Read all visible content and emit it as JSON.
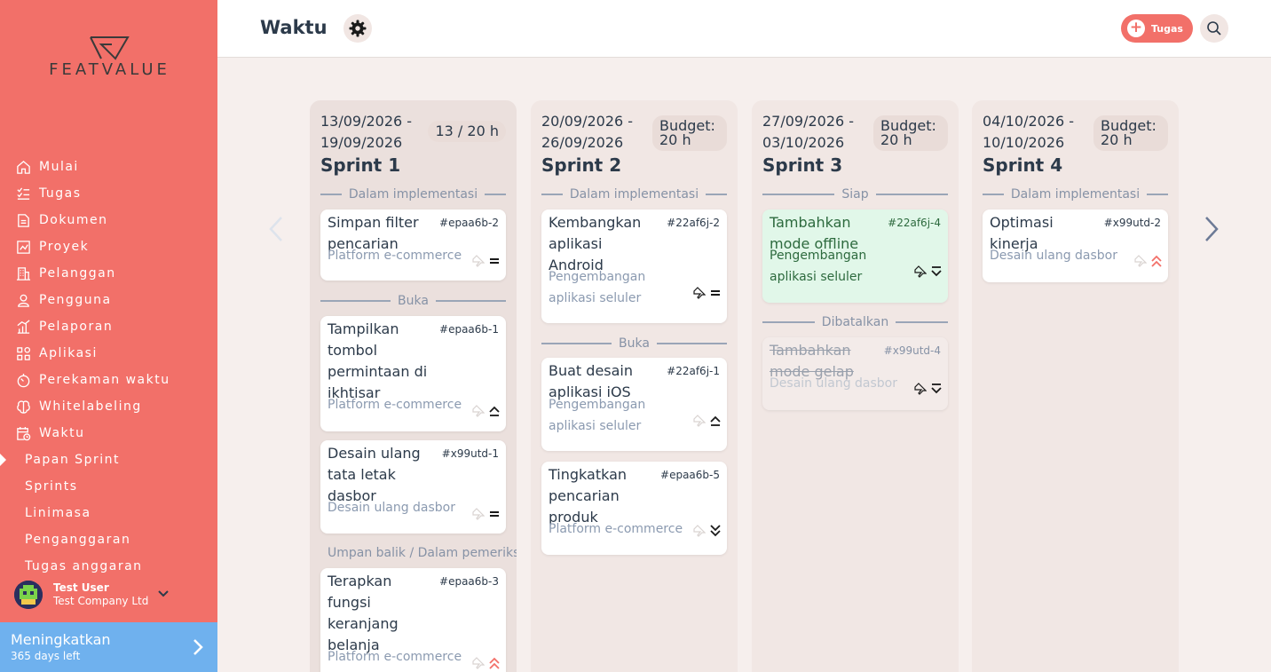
{
  "brand": {
    "name": "FEATVALUE"
  },
  "nav": {
    "items": [
      {
        "label": "Mulai",
        "icon": "home-icon"
      },
      {
        "label": "Tugas",
        "icon": "checklist-icon"
      },
      {
        "label": "Dokumen",
        "icon": "document-icon"
      },
      {
        "label": "Proyek",
        "icon": "project-icon"
      },
      {
        "label": "Pelanggan",
        "icon": "building-icon"
      },
      {
        "label": "Pengguna",
        "icon": "user-icon"
      },
      {
        "label": "Pelaporan",
        "icon": "report-icon"
      },
      {
        "label": "Aplikasi",
        "icon": "apps-icon"
      },
      {
        "label": "Perekaman waktu",
        "icon": "timer-icon"
      },
      {
        "label": "Whitelabeling",
        "icon": "brain-icon"
      },
      {
        "label": "Waktu",
        "icon": "calendar-clock-icon"
      }
    ],
    "sub_items": [
      {
        "label": "Papan Sprint",
        "active": true
      },
      {
        "label": "Sprints"
      },
      {
        "label": "Linimasa"
      },
      {
        "label": "Penganggaran"
      },
      {
        "label": "Tugas anggaran"
      }
    ]
  },
  "user": {
    "name": "Test User",
    "company": "Test Company Ltd"
  },
  "upgrade": {
    "title": "Meningkatkan",
    "subtitle": "365 days left"
  },
  "header": {
    "title": "Waktu",
    "task_button": "Tugas"
  },
  "sprints": [
    {
      "dates": "13/09/2026 - 19/09/2026",
      "badge": "13 / 20 h",
      "title": "Sprint 1",
      "groups": [
        {
          "label": "Dalam implementasi",
          "cards": [
            {
              "title": "Simpan filter pencarian",
              "id": "#epaa6b-2",
              "project": "Platform e-commerce",
              "priority": "medium"
            }
          ]
        },
        {
          "label": "Buka",
          "cards": [
            {
              "title": "Tampilkan tombol permintaan di ikhtisar",
              "id": "#epaa6b-1",
              "project": "Platform e-commerce",
              "priority": "high"
            },
            {
              "title": "Desain ulang tata letak dasbor",
              "id": "#x99utd-1",
              "project": "Desain ulang dasbor",
              "priority": "medium"
            }
          ]
        },
        {
          "label": "Umpan balik / Dalam pemeriksaan",
          "cards": [
            {
              "title": "Terapkan fungsi keranjang belanja",
              "id": "#epaa6b-3",
              "project": "Platform e-commerce",
              "priority": "urgent"
            }
          ]
        }
      ]
    },
    {
      "dates": "20/09/2026 - 26/09/2026",
      "badge": "Budget: 20 h",
      "title": "Sprint 2",
      "groups": [
        {
          "label": "Dalam implementasi",
          "cards": [
            {
              "title": "Kembangkan aplikasi Android",
              "id": "#22af6j-2",
              "project": "Pengembangan aplikasi seluler",
              "priority": "medium"
            }
          ]
        },
        {
          "label": "Buka",
          "cards": [
            {
              "title": "Buat desain aplikasi iOS",
              "id": "#22af6j-1",
              "project": "Pengembangan aplikasi seluler",
              "priority": "high"
            },
            {
              "title": "Tingkatkan pencarian produk",
              "id": "#epaa6b-5",
              "project": "Platform e-commerce",
              "priority": "lowest"
            }
          ]
        }
      ]
    },
    {
      "dates": "27/09/2026 - 03/10/2026",
      "badge": "Budget: 20 h",
      "title": "Sprint 3",
      "groups": [
        {
          "label": "Siap",
          "cards": [
            {
              "title": "Tambahkan mode offline",
              "id": "#22af6j-4",
              "project": "Pengembangan aplikasi seluler",
              "priority": "low"
            }
          ]
        },
        {
          "label": "Dibatalkan",
          "cards": [
            {
              "title": "Tambahkan mode gelap",
              "id": "#x99utd-4",
              "project": "Desain ulang dasbor",
              "priority": "low"
            }
          ]
        }
      ]
    },
    {
      "dates": "04/10/2026 - 10/10/2026",
      "badge": "Budget: 20 h",
      "title": "Sprint 4",
      "groups": [
        {
          "label": "Dalam implementasi",
          "cards": [
            {
              "title": "Optimasi kinerja",
              "id": "#x99utd-2",
              "project": "Desain ulang dasbor",
              "priority": "urgent"
            }
          ]
        }
      ]
    }
  ],
  "colors": {
    "brand": "#f27069",
    "upgrade": "#6fb1ee",
    "text": "#2c3a4a",
    "muted": "#8692a6",
    "done_bg": "#e1f7e9",
    "urgent": "#f27069"
  }
}
